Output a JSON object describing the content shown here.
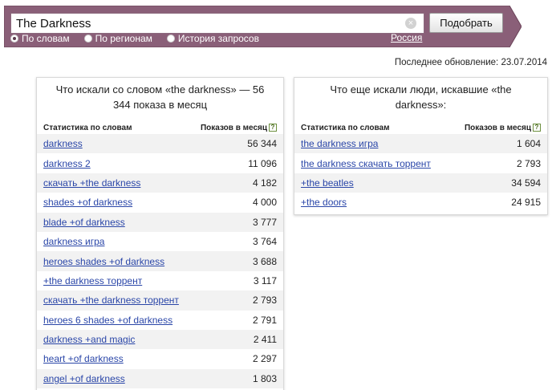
{
  "search": {
    "query": "The Darkness",
    "submit_label": "Подобрать",
    "clear_glyph": "×"
  },
  "modes": [
    {
      "label": "По словам",
      "selected": true
    },
    {
      "label": "По регионам",
      "selected": false
    },
    {
      "label": "История запросов",
      "selected": false
    }
  ],
  "region": "Россия",
  "last_update": "Последнее обновление: 23.07.2014",
  "colors": {
    "header_bg": "#8a5f78",
    "header_border": "#6b4459",
    "link": "#2a46a8",
    "row_stripe": "#f2f2f2"
  },
  "left_panel": {
    "title": "Что искали со словом «the darkness» — 56 344 показа в месяц",
    "col_phrase": "Статистика по словам",
    "col_count": "Показов в месяц",
    "help_glyph": "?",
    "rows": [
      {
        "phrase": "darkness",
        "count": "56 344"
      },
      {
        "phrase": "darkness 2",
        "count": "11 096"
      },
      {
        "phrase": "скачать +the darkness",
        "count": "4 182"
      },
      {
        "phrase": "shades +of darkness",
        "count": "4 000"
      },
      {
        "phrase": "blade +of darkness",
        "count": "3 777"
      },
      {
        "phrase": "darkness игра",
        "count": "3 764"
      },
      {
        "phrase": "heroes shades +of darkness",
        "count": "3 688"
      },
      {
        "phrase": "+the darkness торрент",
        "count": "3 117"
      },
      {
        "phrase": "скачать +the darkness торрент",
        "count": "2 793"
      },
      {
        "phrase": "heroes 6 shades +of darkness",
        "count": "2 791"
      },
      {
        "phrase": "darkness +and magic",
        "count": "2 411"
      },
      {
        "phrase": "heart +of darkness",
        "count": "2 297"
      },
      {
        "phrase": "angel +of darkness",
        "count": "1 803"
      }
    ]
  },
  "right_panel": {
    "title": "Что еще искали люди, искавшие «the darkness»:",
    "col_phrase": "Статистика по словам",
    "col_count": "Показов в месяц",
    "help_glyph": "?",
    "rows": [
      {
        "phrase": "the darkness игра",
        "count": "1 604"
      },
      {
        "phrase": "the darkness скачать торрент",
        "count": "2 793"
      },
      {
        "phrase": "+the beatles",
        "count": "34 594"
      },
      {
        "phrase": "+the doors",
        "count": "24 915"
      }
    ]
  }
}
